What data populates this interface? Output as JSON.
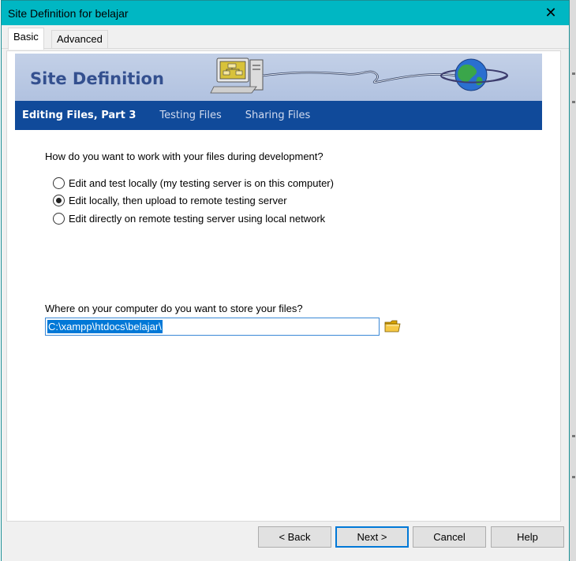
{
  "window": {
    "title": "Site Definition for belajar",
    "close_glyph": "✕"
  },
  "tabs": [
    {
      "label": "Basic",
      "active": true
    },
    {
      "label": "Advanced",
      "active": false
    }
  ],
  "banner": {
    "title": "Site Definition",
    "icons": [
      "computer-icon",
      "globe-icon"
    ]
  },
  "steps": [
    {
      "label": "Editing Files, Part 3",
      "current": true
    },
    {
      "label": "Testing Files",
      "current": false
    },
    {
      "label": "Sharing Files",
      "current": false
    }
  ],
  "question1": "How do you want to work with your files during development?",
  "options": [
    {
      "label": "Edit and test locally (my testing server is on this computer)",
      "checked": false
    },
    {
      "label": "Edit locally, then upload to remote testing server",
      "checked": true
    },
    {
      "label": "Edit directly on remote testing server using local network",
      "checked": false
    }
  ],
  "question2": "Where on your computer do you want to store your files?",
  "path_value": "C:\\xampp\\htdocs\\belajar\\",
  "buttons": {
    "back": "< Back",
    "next": "Next >",
    "cancel": "Cancel",
    "help": "Help"
  },
  "colors": {
    "titlebar": "#00b7c3",
    "stepbar": "#104a9a",
    "banner_title": "#34508f",
    "selection": "#0078d7"
  }
}
